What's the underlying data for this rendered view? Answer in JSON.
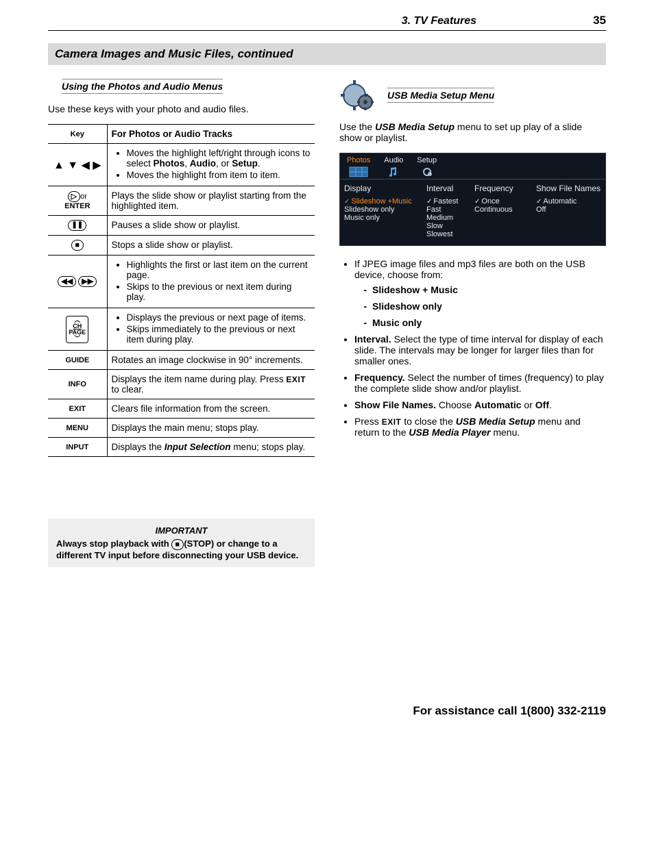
{
  "header": {
    "chapter": "3.  TV Features",
    "page": "35"
  },
  "section_banner": "Camera Images and Music Files, continued",
  "left": {
    "sub_heading": "Using the Photos and Audio Menus",
    "intro": "Use these keys with your photo and audio files.",
    "th_key": "Key",
    "th_desc": "For Photos or Audio Tracks",
    "rows": {
      "r1": {
        "key_glyphs": "▲ ▼ ◀ ▶",
        "b1a": "Moves the highlight left/right through icons to select ",
        "b1b": "Photos",
        "b1c": ", ",
        "b1d": "Audio",
        "b1e": ", or ",
        "b1f": "Setup",
        "b1g": ".",
        "b2": "Moves the highlight from item to item."
      },
      "r2": {
        "key_or": "or",
        "key_enter": "ENTER",
        "d": "Plays the slide show or playlist starting from the highlighted item."
      },
      "r3": {
        "d": "Pauses a slide show or playlist."
      },
      "r4": {
        "d": "Stops a slide show or playlist."
      },
      "r5": {
        "b1": "Highlights the first or last item on the current page.",
        "b2": "Skips to the previous or next item during play."
      },
      "r6": {
        "b1": "Displays the previous or next page of items.",
        "b2": "Skips immediately to the previous or next item during play."
      },
      "r7": {
        "key": "GUIDE",
        "d": "Rotates an image clockwise in 90° increments."
      },
      "r8": {
        "key": "INFO",
        "d1": "Displays the item name during play.  Press ",
        "d2": "EXIT",
        "d3": " to clear."
      },
      "r9": {
        "key": "EXIT",
        "d": "Clears file information from the screen."
      },
      "r10": {
        "key": "MENU",
        "d": "Displays the main menu; stops play."
      },
      "r11": {
        "key": "INPUT",
        "d1": "Displays the ",
        "d2": "Input Selection",
        "d3": " menu; stops play."
      }
    },
    "note": {
      "title": "IMPORTANT",
      "t1": "Always stop playback with ",
      "t2": "(STOP)",
      "t3": " or change to a different TV input before disconnecting your USB device."
    }
  },
  "right": {
    "sub_heading": "USB Media Setup Menu",
    "intro1": "Use the ",
    "intro2": "USB Media Setup",
    "intro3": " menu to set up play of a slide show or playlist.",
    "menu": {
      "tabs": {
        "photos": "Photos",
        "audio": "Audio",
        "setup": "Setup"
      },
      "heads": {
        "display": "Display",
        "interval": "Interval",
        "frequency": "Frequency",
        "show": "Show File Names"
      },
      "col1": {
        "a": "Slideshow +Music",
        "b": "Slideshow only",
        "c": "Music only"
      },
      "col2": {
        "a": "Fastest",
        "b": "Fast",
        "c": "Medium",
        "d": "Slow",
        "e": "Slowest"
      },
      "col3": {
        "a": "Once",
        "b": "Continuous"
      },
      "col4": {
        "a": "Automatic",
        "b": "Off"
      }
    },
    "bullets": {
      "b1": "If JPEG image files and mp3 files are both on the USB device, choose from:",
      "b1a": "Slideshow + Music",
      "b1b": "Slideshow only",
      "b1c": "Music only",
      "b2a": "Interval.",
      "b2b": "  Select the type of time interval for display of each slide.  The intervals may be longer for larger files than for smaller ones.",
      "b3a": "Frequency.",
      "b3b": "  Select the number of times (frequency) to play the complete slide show and/or playlist.",
      "b4a": "Show File Names.",
      "b4b": "  Choose ",
      "b4c": "Automatic",
      "b4d": " or ",
      "b4e": "Off",
      "b4f": ".",
      "b5a": "Press ",
      "b5b": "EXIT",
      "b5c": " to close the ",
      "b5d": "USB Media Setup",
      "b5e": " menu and return to the ",
      "b5f": "USB Media Player",
      "b5g": " menu."
    }
  },
  "footer": "For assistance call 1(800) 332-2119"
}
